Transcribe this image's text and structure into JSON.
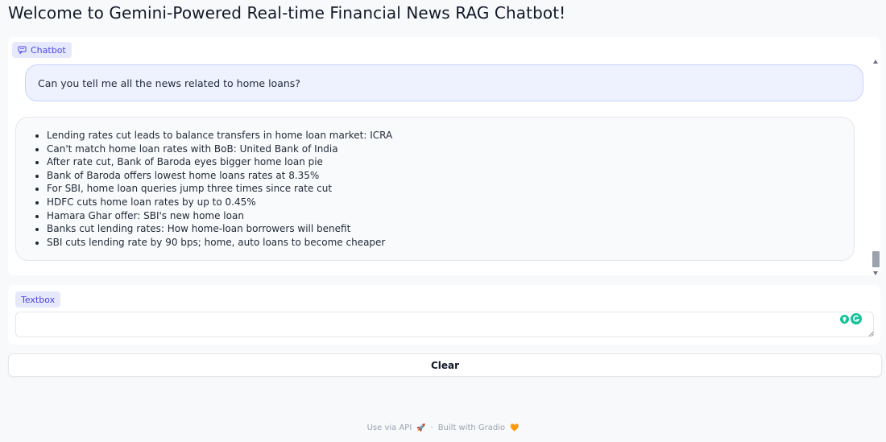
{
  "page": {
    "title": "Welcome to Gemini-Powered Real-time Financial News RAG Chatbot!"
  },
  "chatbot": {
    "label": "Chatbot",
    "user_message": "Can you tell me all the news related to home loans?",
    "bot_items": [
      "Lending rates cut leads to balance transfers in home loan market: ICRA",
      "Can't match home loan rates with BoB: United Bank of India",
      "After rate cut, Bank of Baroda eyes bigger home loan pie",
      "Bank of Baroda offers lowest home loans rates at 8.35%",
      "For SBI, home loan queries jump three times since rate cut",
      "HDFC cuts home loan rates by up to 0.45%",
      "Hamara Ghar offer: SBI's new home loan",
      "Banks cut lending rates: How home-loan borrowers will benefit",
      "SBI cuts lending rate by 90 bps; home, auto loans to become cheaper"
    ]
  },
  "textbox": {
    "label": "Textbox",
    "value": "",
    "placeholder": ""
  },
  "clear_button": {
    "label": "Clear"
  },
  "footer": {
    "api_link": "Use via API",
    "api_emoji": "🚀",
    "separator": "·",
    "built_with": "Built with Gradio",
    "gradio_emoji": "🧡"
  },
  "colors": {
    "accent": "#4f46e5",
    "label_bg": "#e5e9fb",
    "user_bubble": "#eef2ff",
    "grammarly": "#15c39a"
  }
}
